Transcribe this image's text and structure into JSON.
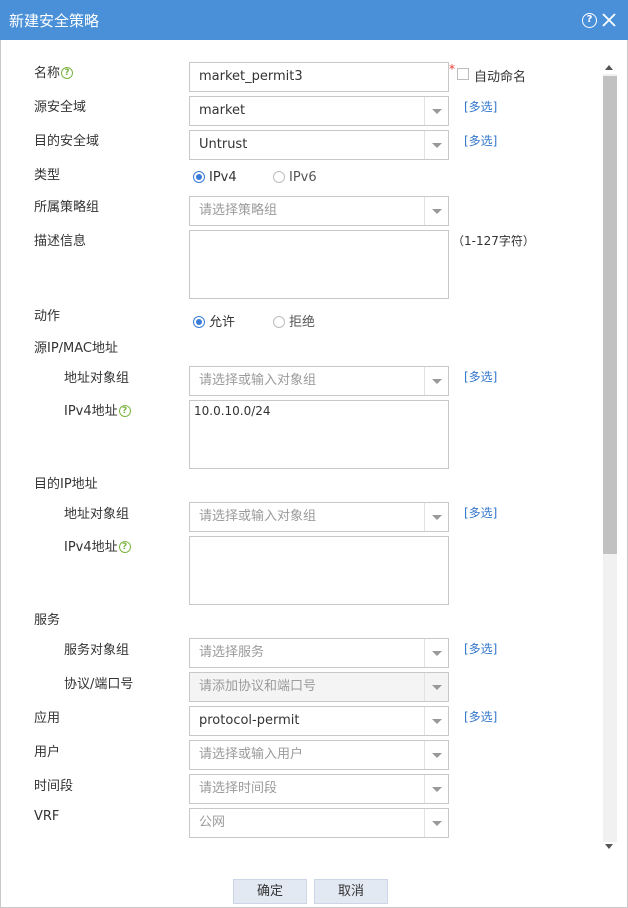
{
  "window": {
    "title": "新建安全策略"
  },
  "form": {
    "name": {
      "label": "名称",
      "value": "market_permit3",
      "required_mark": "*",
      "auto_name_label": "自动命名"
    },
    "src_zone": {
      "label": "源安全域",
      "value": "market",
      "multi": "[多选]"
    },
    "dst_zone": {
      "label": "目的安全域",
      "value": "Untrust",
      "multi": "[多选]"
    },
    "type": {
      "label": "类型",
      "options": [
        "IPv4",
        "IPv6"
      ],
      "selected": "IPv4"
    },
    "group": {
      "label": "所属策略组",
      "placeholder": "请选择策略组"
    },
    "desc": {
      "label": "描述信息",
      "value": "",
      "hint": "（1-127字符）"
    },
    "action": {
      "label": "动作",
      "options": [
        "允许",
        "拒绝"
      ],
      "selected": "允许"
    },
    "src_ip": {
      "label": "源IP/MAC地址",
      "obj_group_label": "地址对象组",
      "obj_group_placeholder": "请选择或输入对象组",
      "multi": "[多选]",
      "ipv4_label": "IPv4地址",
      "ipv4_value": "10.0.10.0/24"
    },
    "dst_ip": {
      "label": "目的IP地址",
      "obj_group_label": "地址对象组",
      "obj_group_placeholder": "请选择或输入对象组",
      "multi": "[多选]",
      "ipv4_label": "IPv4地址",
      "ipv4_value": ""
    },
    "service": {
      "label": "服务",
      "obj_group_label": "服务对象组",
      "obj_group_placeholder": "请选择服务",
      "multi": "[多选]",
      "proto_label": "协议/端口号",
      "proto_placeholder": "请添加协议和端口号"
    },
    "app": {
      "label": "应用",
      "value": "protocol-permit",
      "multi": "[多选]"
    },
    "user": {
      "label": "用户",
      "placeholder": "请选择或输入用户"
    },
    "time": {
      "label": "时间段",
      "placeholder": "请选择时间段"
    },
    "vrf": {
      "label": "VRF",
      "value": "公网"
    }
  },
  "buttons": {
    "ok": "确定",
    "cancel": "取消"
  },
  "icons": {
    "help": "help-icon",
    "close": "close-icon",
    "info": "question-icon"
  },
  "colors": {
    "titlebar": "#4a90d9",
    "link": "#3377cc",
    "radio": "#3a7dd8",
    "info": "#7cb342"
  }
}
